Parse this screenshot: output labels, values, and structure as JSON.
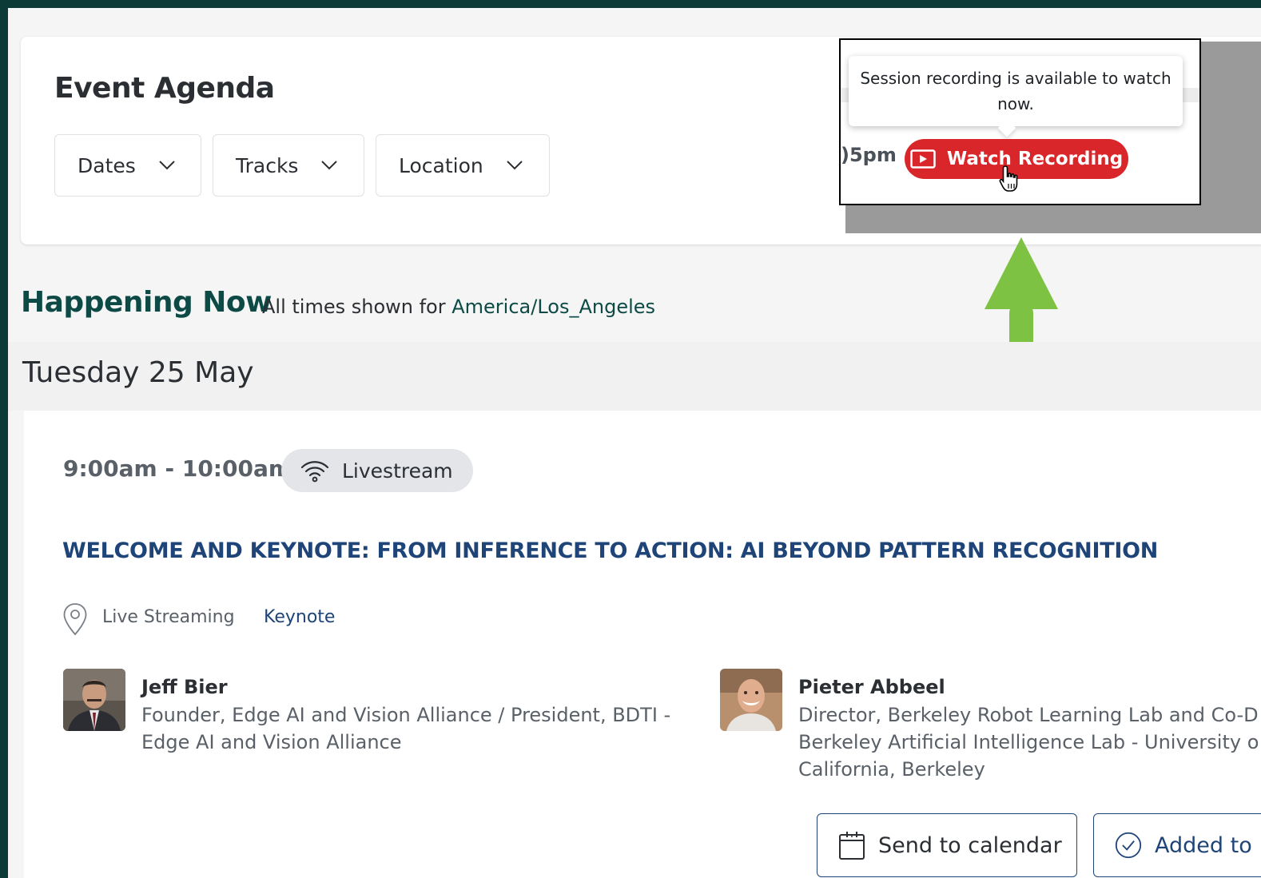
{
  "header": {
    "title": "Event Agenda",
    "filters": {
      "dates": "Dates",
      "tracks": "Tracks",
      "location": "Location"
    }
  },
  "popup": {
    "tooltip_text": "Session recording is available to watch now.",
    "time_fragment": ")5pm",
    "watch_button": "Watch Recording"
  },
  "happening": {
    "title": "Happening Now",
    "tz_prefix": "All times shown for ",
    "tz_value": "America/Los_Angeles"
  },
  "day": "Tuesday 25 May",
  "session": {
    "time": "9:00am - 10:00am",
    "badge": "Livestream",
    "title": "WELCOME AND KEYNOTE: FROM INFERENCE TO ACTION: AI BEYOND PATTERN RECOGNITION",
    "location": "Live Streaming",
    "track": "Keynote",
    "speakers": [
      {
        "name": "Jeff Bier",
        "description": "Founder, Edge AI and Vision Alliance / President, BDTI - Edge AI and Vision Alliance"
      },
      {
        "name": "Pieter Abbeel",
        "description_line1": "Director, Berkeley Robot Learning Lab and Co-D",
        "description_line2": "Berkeley Artificial Intelligence Lab - University o",
        "description_line3": "California, Berkeley"
      }
    ],
    "actions": {
      "calendar": "Send to calendar",
      "added": "Added to"
    }
  },
  "colors": {
    "brand_dark": "#0d4a45",
    "title_blue": "#1e4478",
    "watch_red": "#d9262b",
    "arrow_green": "#7dc242"
  }
}
